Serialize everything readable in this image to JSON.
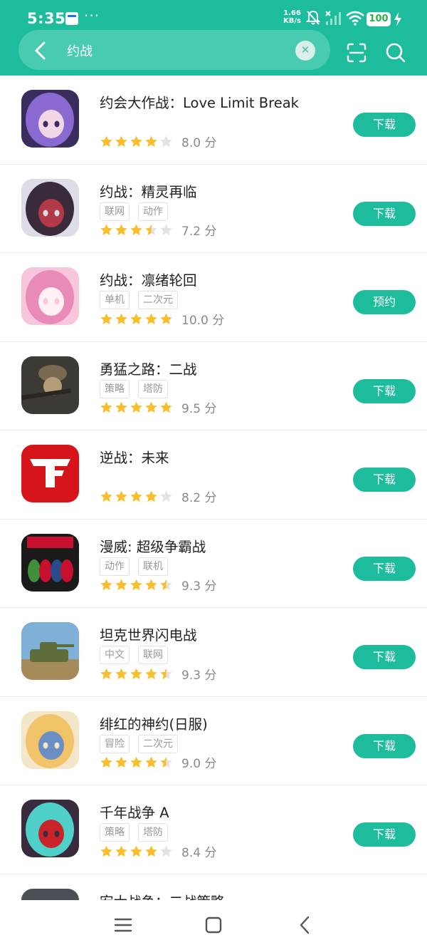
{
  "status_bar": {
    "time": "5:35",
    "more": "···",
    "net_speed_value": "1.66",
    "net_speed_unit": "KB/s",
    "battery": "100"
  },
  "search": {
    "query": "约战"
  },
  "colors": {
    "accent": "#1cbc9c",
    "star_filled": "#f9be2b",
    "star_empty": "#e3e3e3"
  },
  "apps": [
    {
      "title": "约会大作战：Love Limit Break",
      "tags": [],
      "stars": 4,
      "score": "8.0 分",
      "action": "下载"
    },
    {
      "title": "约战：精灵再临",
      "tags": [
        "联网",
        "动作"
      ],
      "stars": 3.5,
      "score": "7.2 分",
      "action": "下载"
    },
    {
      "title": "约战：凛绪轮回",
      "tags": [
        "单机",
        "二次元"
      ],
      "stars": 5,
      "score": "10.0 分",
      "action": "预约"
    },
    {
      "title": "勇猛之路：二战",
      "tags": [
        "策略",
        "塔防"
      ],
      "stars": 5,
      "score": "9.5 分",
      "action": "下载"
    },
    {
      "title": "逆战：未来",
      "tags": [],
      "stars": 4,
      "score": "8.2 分",
      "action": "下载"
    },
    {
      "title": "漫威: 超级争霸战",
      "tags": [
        "动作",
        "联机"
      ],
      "stars": 4.5,
      "score": "9.3 分",
      "action": "下载"
    },
    {
      "title": "坦克世界闪电战",
      "tags": [
        "中文",
        "联网"
      ],
      "stars": 4.5,
      "score": "9.3 分",
      "action": "下载"
    },
    {
      "title": "绯红的神约(日服)",
      "tags": [
        "冒险",
        "二次元"
      ],
      "stars": 4.5,
      "score": "9.0 分",
      "action": "下载"
    },
    {
      "title": "千年战争 A",
      "tags": [
        "策略",
        "塔防"
      ],
      "stars": 4,
      "score": "8.4 分",
      "action": "下载"
    }
  ],
  "partial_app": {
    "title": "宏大战争：二战策略"
  },
  "icon_art": [
    {
      "name": "anime-girl-purple-icon",
      "colors": [
        "#3a2d5e",
        "#8a6ad0",
        "#f2d6e6"
      ]
    },
    {
      "name": "anime-pair-icon",
      "colors": [
        "#dcdde6",
        "#3a2b3a",
        "#b23a48"
      ]
    },
    {
      "name": "anime-girl-pink-icon",
      "colors": [
        "#f7c6dd",
        "#e98bb8",
        "#fff0f6"
      ]
    },
    {
      "name": "soldier-rifle-icon",
      "colors": [
        "#3c3a34",
        "#7a6a52",
        "#b59d7a"
      ]
    },
    {
      "name": "red-logo-icon",
      "colors": [
        "#d8141b",
        "#ff3a3a",
        "#ffffff"
      ]
    },
    {
      "name": "marvel-heroes-icon",
      "colors": [
        "#c8102e",
        "#2a4a8a",
        "#1a1a1a"
      ]
    },
    {
      "name": "tank-icon",
      "colors": [
        "#7fb0d8",
        "#5f6d3a",
        "#a58a5a"
      ]
    },
    {
      "name": "anime-blonde-icon",
      "colors": [
        "#f4e6c8",
        "#f2c46a",
        "#6a8fc4"
      ]
    },
    {
      "name": "anime-teal-hair-icon",
      "colors": [
        "#3a2a3e",
        "#4fd0c8",
        "#c9242a"
      ]
    }
  ]
}
